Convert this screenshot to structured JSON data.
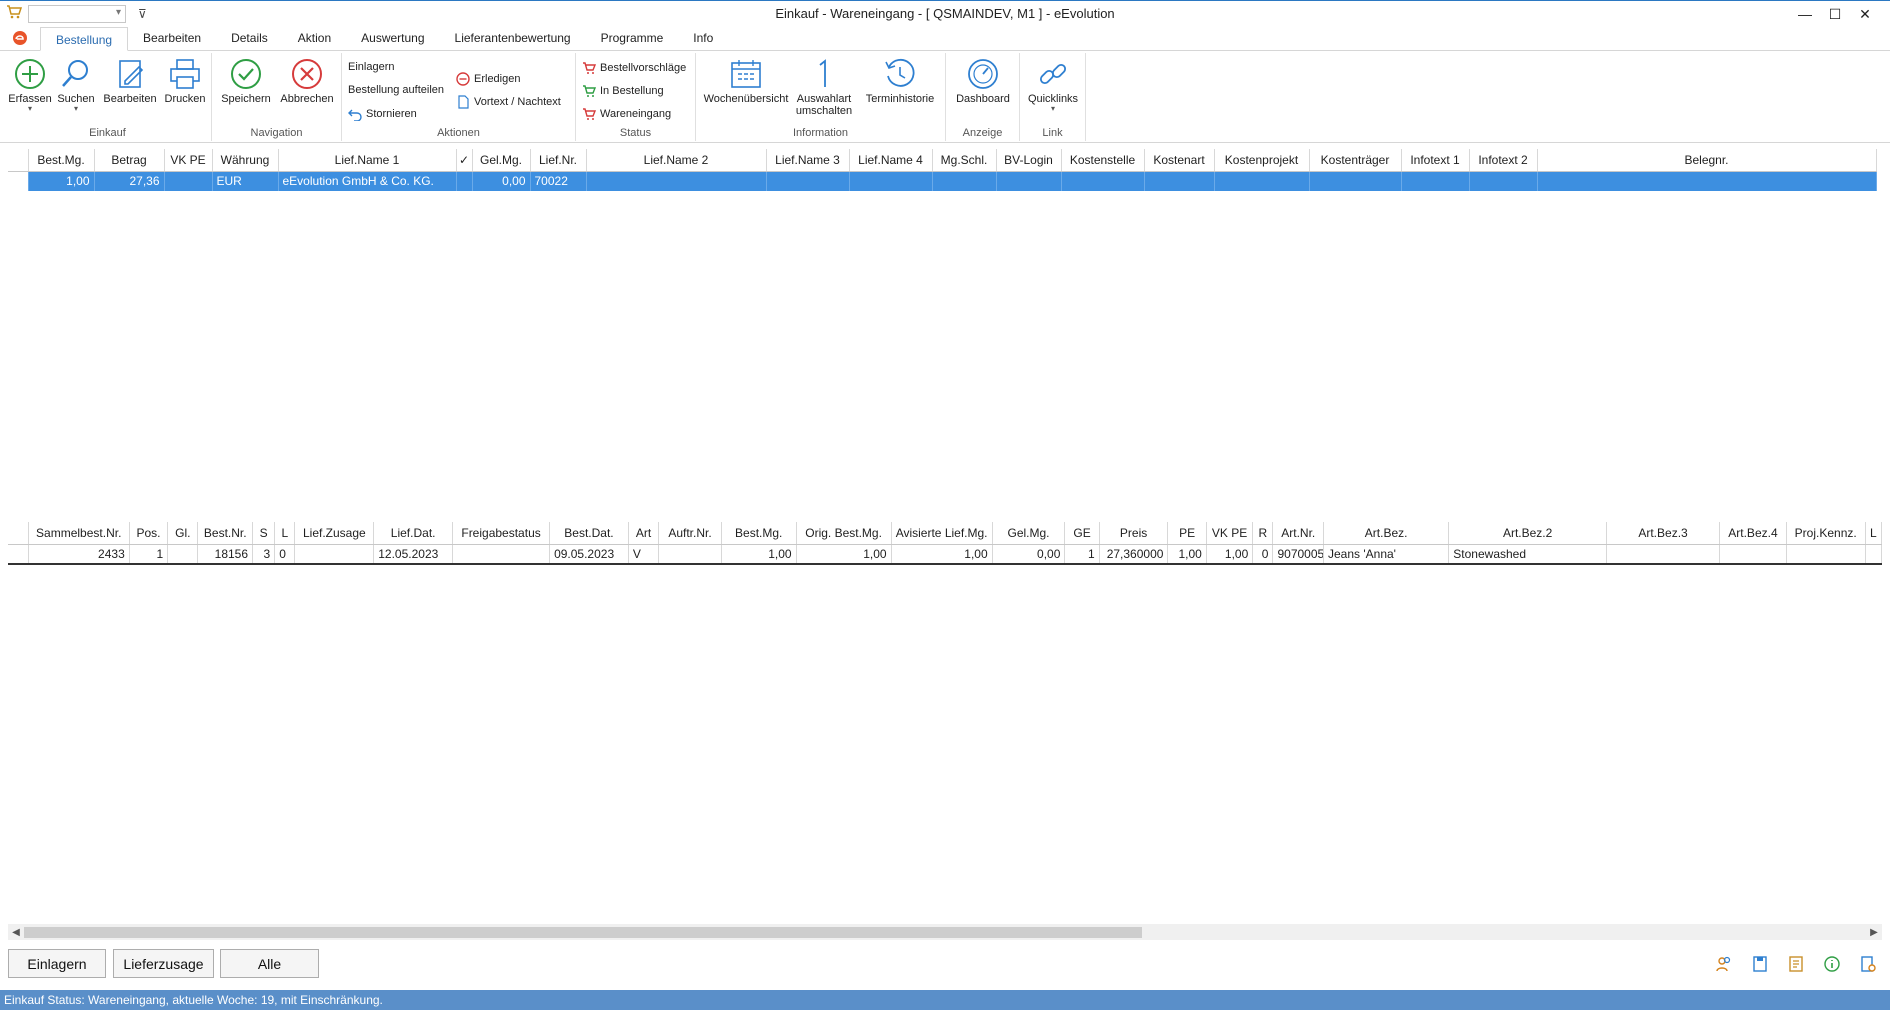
{
  "window": {
    "title": "Einkauf - Wareneingang - [ QSMAINDEV, M1 ]  -  eEvolution"
  },
  "tabs": [
    "Bestellung",
    "Bearbeiten",
    "Details",
    "Aktion",
    "Auswertung",
    "Lieferantenbewertung",
    "Programme",
    "Info"
  ],
  "ribbon": {
    "einkauf": {
      "label": "Einkauf",
      "erfassen": "Erfassen",
      "suchen": "Suchen",
      "bearbeiten": "Bearbeiten",
      "drucken": "Drucken"
    },
    "navigation": {
      "label": "Navigation",
      "speichern": "Speichern",
      "abbrechen": "Abbrechen"
    },
    "aktionen": {
      "label": "Aktionen",
      "einlagern": "Einlagern",
      "aufteilen": "Bestellung aufteilen",
      "stornieren": "Stornieren",
      "erledigen": "Erledigen",
      "vortext": "Vortext / Nachtext"
    },
    "status": {
      "label": "Status",
      "vorschlaege": "Bestellvorschläge",
      "in_bestellung": "In Bestellung",
      "wareneingang": "Wareneingang"
    },
    "information": {
      "label": "Information",
      "wochen": "Wochenübersicht",
      "auswahl1": "Auswahlart",
      "auswahl2": "umschalten",
      "termin": "Terminhistorie"
    },
    "anzeige": {
      "label": "Anzeige",
      "dashboard": "Dashboard"
    },
    "link": {
      "label": "Link",
      "quicklinks": "Quicklinks"
    }
  },
  "top_grid": {
    "columns": [
      "Best.Mg.",
      "Betrag",
      "VK PE",
      "Währung",
      "Lief.Name 1",
      "✓",
      "Gel.Mg.",
      "Lief.Nr.",
      "Lief.Name 2",
      "Lief.Name 3",
      "Lief.Name 4",
      "Mg.Schl.",
      "BV-Login",
      "Kostenstelle",
      "Kostenart",
      "Kostenprojekt",
      "Kostenträger",
      "Infotext 1",
      "Infotext 2",
      "Belegnr."
    ],
    "row": [
      "1,00",
      "27,36",
      "",
      "EUR",
      "eEvolution GmbH & Co. KG.",
      "",
      "0,00",
      "70022",
      "",
      "",
      "",
      "",
      "",
      "",
      "",
      "",
      "",
      "",
      "",
      ""
    ]
  },
  "bottom_grid": {
    "columns": [
      "Sammelbest.Nr.",
      "Pos.",
      "Gl.",
      "Best.Nr.",
      "S",
      "L",
      "Lief.Zusage",
      "Lief.Dat.",
      "Freigabestatus",
      "Best.Dat.",
      "Art",
      "Auftr.Nr.",
      "Best.Mg.",
      "Orig. Best.Mg.",
      "Avisierte Lief.Mg.",
      "Gel.Mg.",
      "GE",
      "Preis",
      "PE",
      "VK PE",
      "R",
      "Art.Nr.",
      "Art.Bez.",
      "Art.Bez.2",
      "Art.Bez.3",
      "Art.Bez.4",
      "Proj.Kennz.",
      "L"
    ],
    "row": [
      "2433",
      "1",
      "",
      "18156",
      "3",
      "0",
      "",
      "12.05.2023",
      "",
      "09.05.2023",
      "V",
      "",
      "1,00",
      "1,00",
      "1,00",
      "0,00",
      "1",
      "27,360000",
      "1,00",
      "1,00",
      "0",
      "9070005",
      "Jeans 'Anna'",
      "Stonewashed",
      "",
      "",
      "",
      ""
    ]
  },
  "buttons": {
    "einlagern": "Einlagern",
    "lieferzusage": "Lieferzusage",
    "alle": "Alle"
  },
  "status_bar": "Einkauf Status: Wareneingang, aktuelle Woche: 19, mit Einschränkung.",
  "colors": {
    "selection": "#3d8fe0",
    "status_bar": "#5a8fc9",
    "accent": "#2b6cb0"
  }
}
